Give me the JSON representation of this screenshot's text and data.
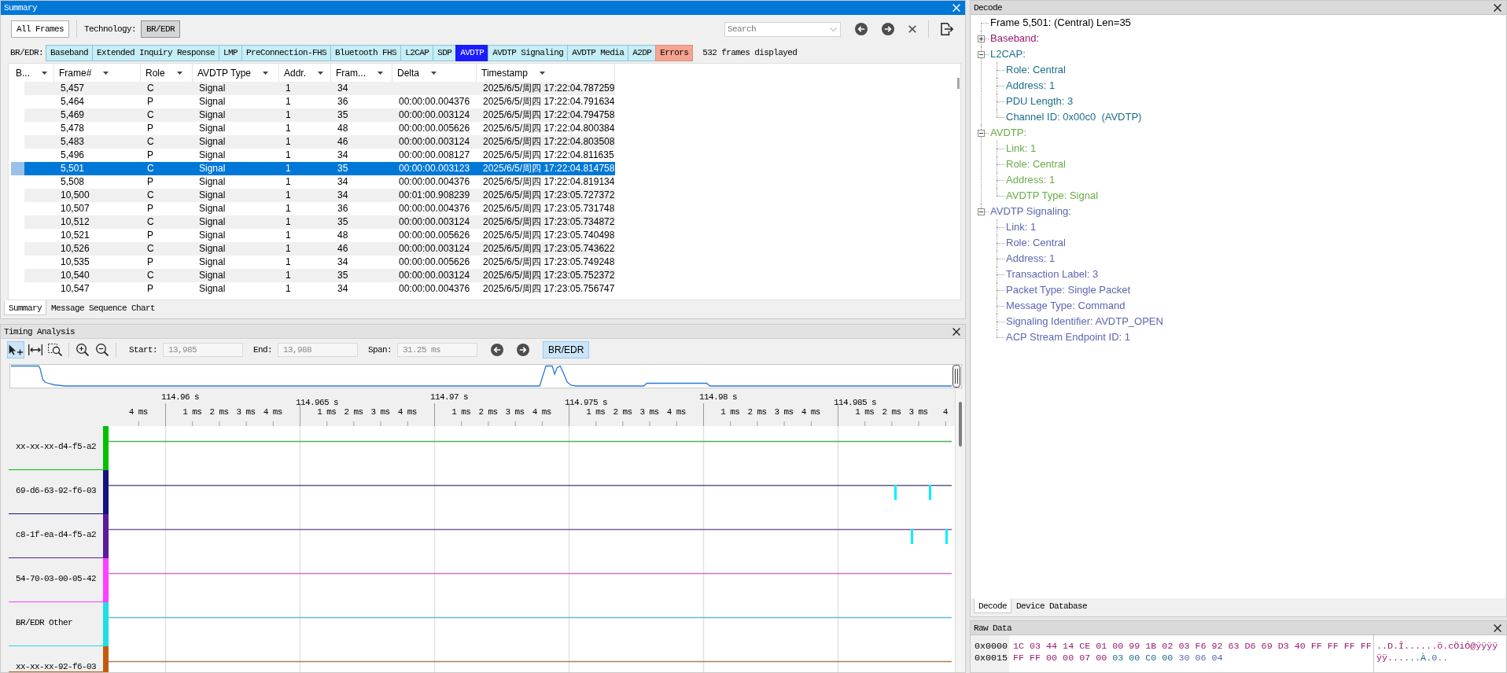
{
  "summary": {
    "title": "Summary",
    "toolbar": {
      "all_frames": {
        "label": "All Frames",
        "selected": false
      },
      "technology_label": "Technology:",
      "technology": {
        "label": "BR/EDR",
        "selected": true
      },
      "search": {
        "placeholder": "Search"
      }
    },
    "filter": {
      "label": "BR/EDR:",
      "tabs": [
        {
          "label": "Baseband",
          "kind": "protocol",
          "selected": false
        },
        {
          "label": "Extended Inquiry Response",
          "kind": "protocol",
          "selected": false
        },
        {
          "label": "LMP",
          "kind": "protocol",
          "selected": false
        },
        {
          "label": "PreConnection-FHS",
          "kind": "protocol",
          "selected": false
        },
        {
          "label": "Bluetooth FHS",
          "kind": "protocol",
          "selected": false
        },
        {
          "label": "L2CAP",
          "kind": "protocol",
          "selected": false
        },
        {
          "label": "SDP",
          "kind": "protocol",
          "selected": false
        },
        {
          "label": "AVDTP",
          "kind": "protocol",
          "selected": true
        },
        {
          "label": "AVDTP Signaling",
          "kind": "protocol",
          "selected": false
        },
        {
          "label": "AVDTP Media",
          "kind": "protocol",
          "selected": false
        },
        {
          "label": "A2DP",
          "kind": "protocol",
          "selected": false
        },
        {
          "label": "Errors",
          "kind": "errors",
          "selected": false
        }
      ],
      "count": "532 frames displayed"
    },
    "table": {
      "columns": [
        "B...",
        "Frame#",
        "Role",
        "AVDTP Type",
        "Addr.",
        "Fram...",
        "Delta",
        "Timestamp"
      ],
      "rows": [
        {
          "frame": "5,457",
          "role": "C",
          "avdtp_type": "Signal",
          "addr": "1",
          "column_6": "34",
          "timestamp": "2025/6/5/周四 17:22:04.787259",
          "selected": false
        },
        {
          "frame": "5,464",
          "role": "P",
          "avdtp_type": "Signal",
          "addr": "1",
          "column_6": "36",
          "delta": "00:00:00.004376",
          "timestamp": "2025/6/5/周四 17:22:04.791634",
          "selected": false
        },
        {
          "frame": "5,469",
          "role": "C",
          "avdtp_type": "Signal",
          "addr": "1",
          "column_6": "35",
          "delta": "00:00:00.003124",
          "timestamp": "2025/6/5/周四 17:22:04.794758",
          "selected": false
        },
        {
          "frame": "5,478",
          "role": "P",
          "avdtp_type": "Signal",
          "addr": "1",
          "column_6": "48",
          "delta": "00:00:00.005626",
          "timestamp": "2025/6/5/周四 17:22:04.800384",
          "selected": false
        },
        {
          "frame": "5,483",
          "role": "C",
          "avdtp_type": "Signal",
          "addr": "1",
          "column_6": "46",
          "delta": "00:00:00.003124",
          "timestamp": "2025/6/5/周四 17:22:04.803508",
          "selected": false
        },
        {
          "frame": "5,496",
          "role": "P",
          "avdtp_type": "Signal",
          "addr": "1",
          "column_6": "34",
          "delta": "00:00:00.008127",
          "timestamp": "2025/6/5/周四 17:22:04.811635",
          "selected": false
        },
        {
          "frame": "5,501",
          "role": "C",
          "avdtp_type": "Signal",
          "addr": "1",
          "column_6": "35",
          "delta": "00:00:00.003123",
          "timestamp": "2025/6/5/周四 17:22:04.814758",
          "selected": true
        },
        {
          "frame": "5,508",
          "role": "P",
          "avdtp_type": "Signal",
          "addr": "1",
          "column_6": "34",
          "delta": "00:00:00.004376",
          "timestamp": "2025/6/5/周四 17:22:04.819134",
          "selected": false
        },
        {
          "frame": "10,500",
          "role": "C",
          "avdtp_type": "Signal",
          "addr": "1",
          "column_6": "34",
          "delta": "00:01:00.908239",
          "timestamp": "2025/6/5/周四 17:23:05.727372",
          "selected": false
        },
        {
          "frame": "10,507",
          "role": "P",
          "avdtp_type": "Signal",
          "addr": "1",
          "column_6": "36",
          "delta": "00:00:00.004376",
          "timestamp": "2025/6/5/周四 17:23:05.731748",
          "selected": false
        },
        {
          "frame": "10,512",
          "role": "C",
          "avdtp_type": "Signal",
          "addr": "1",
          "column_6": "35",
          "delta": "00:00:00.003124",
          "timestamp": "2025/6/5/周四 17:23:05.734872",
          "selected": false
        },
        {
          "frame": "10,521",
          "role": "P",
          "avdtp_type": "Signal",
          "addr": "1",
          "column_6": "48",
          "delta": "00:00:00.005626",
          "timestamp": "2025/6/5/周四 17:23:05.740498",
          "selected": false
        },
        {
          "frame": "10,526",
          "role": "C",
          "avdtp_type": "Signal",
          "addr": "1",
          "column_6": "46",
          "delta": "00:00:00.003124",
          "timestamp": "2025/6/5/周四 17:23:05.743622",
          "selected": false
        },
        {
          "frame": "10,535",
          "role": "P",
          "avdtp_type": "Signal",
          "addr": "1",
          "column_6": "34",
          "delta": "00:00:00.005626",
          "timestamp": "2025/6/5/周四 17:23:05.749248",
          "selected": false
        },
        {
          "frame": "10,540",
          "role": "C",
          "avdtp_type": "Signal",
          "addr": "1",
          "column_6": "35",
          "delta": "00:00:00.003124",
          "timestamp": "2025/6/5/周四 17:23:05.752372",
          "selected": false
        },
        {
          "frame": "10,547",
          "role": "P",
          "avdtp_type": "Signal",
          "addr": "1",
          "column_6": "34",
          "delta": "00:00:00.004376",
          "timestamp": "2025/6/5/周四 17:23:05.756747",
          "selected": false
        }
      ]
    },
    "tabs": [
      {
        "label": "Summary",
        "selected": true
      },
      {
        "label": "Message Sequence Chart",
        "selected": false
      }
    ]
  },
  "timing": {
    "title": "Timing Analysis",
    "tools": [
      {
        "kind": "pointer",
        "selected": true
      },
      {
        "kind": "fit",
        "selected": false
      },
      {
        "kind": "zoom_region",
        "selected": false
      },
      {
        "kind": "zoom_in",
        "selected": false
      },
      {
        "kind": "zoom_out",
        "selected": false
      }
    ],
    "fields": [
      {
        "label": "Start:",
        "value": "13,985",
        "disabled": true
      },
      {
        "label": "End:",
        "value": "13,988",
        "disabled": true
      },
      {
        "label": "Span:",
        "value": "31.25 ms",
        "disabled": true
      }
    ],
    "technology": {
      "label": "BR/EDR",
      "selected": true
    },
    "ruler": {
      "lead_ticks": [
        "4 ms"
      ],
      "segments": [
        {
          "label": "114.96 s",
          "ticks": [
            "1 ms",
            "2 ms",
            "3 ms",
            "4 ms"
          ]
        },
        {
          "label": "114.965 s",
          "ticks": [
            "1 ms",
            "2 ms",
            "3 ms",
            "4 ms"
          ]
        },
        {
          "label": "114.97 s",
          "ticks": [
            "1 ms",
            "2 ms",
            "3 ms",
            "4 ms"
          ]
        },
        {
          "label": "114.975 s",
          "ticks": [
            "1 ms",
            "2 ms",
            "3 ms",
            "4 ms"
          ]
        },
        {
          "label": "114.98 s",
          "ticks": [
            "1 ms",
            "2 ms",
            "3 ms",
            "4 ms"
          ]
        },
        {
          "label": "114.985 s",
          "ticks": [
            "1 ms",
            "2 ms",
            "3 ms",
            "4"
          ]
        }
      ]
    },
    "lanes": [
      {
        "label": "xx-xx-xx-d4-f5-a2",
        "color": "#00c000"
      },
      {
        "label": "69-d6-63-92-f6-03",
        "color": "#14147c"
      },
      {
        "label": "c8-1f-ea-d4-f5-a2",
        "color": "#5a1c98"
      },
      {
        "label": "54-70-03-00-05-42",
        "color": "#ff40ff"
      },
      {
        "label": "BR/EDR Other",
        "color": "#20dde8"
      },
      {
        "label": "xx-xx-xx-92-f6-03",
        "color": "#c05c10"
      }
    ]
  },
  "decode": {
    "title": "Decode",
    "tree": [
      {
        "text": "Frame 5,501: (Central) Len=35"
      },
      {
        "text": "Baseband:",
        "color": "#9b1b6e",
        "expanded": false
      },
      {
        "text": "L2CAP:",
        "color": "#1b6e8a",
        "expanded": true,
        "children": [
          {
            "text": "Role: Central"
          },
          {
            "text": "Address: 1"
          },
          {
            "text": "PDU Length: 3"
          },
          {
            "text": "Channel ID: 0x00c0  (AVDTP)"
          }
        ]
      },
      {
        "text": "AVDTP:",
        "color": "#6aab46",
        "expanded": true,
        "children": [
          {
            "text": "Link: 1"
          },
          {
            "text": "Role: Central"
          },
          {
            "text": "Address: 1"
          },
          {
            "text": "AVDTP Type: Signal"
          }
        ]
      },
      {
        "text": "AVDTP Signaling:",
        "color": "#5b67b0",
        "expanded": true,
        "children": [
          {
            "text": "Link: 1"
          },
          {
            "text": "Role: Central"
          },
          {
            "text": "Address: 1"
          },
          {
            "text": "Transaction Label: 3"
          },
          {
            "text": "Packet Type: Single Packet"
          },
          {
            "text": "Message Type: Command"
          },
          {
            "text": "Signaling Identifier: AVDTP_OPEN"
          },
          {
            "text": "ACP Stream Endpoint ID: 1"
          }
        ]
      }
    ],
    "tabs": [
      {
        "label": "Decode",
        "selected": true
      },
      {
        "label": "Device Database",
        "selected": false
      }
    ]
  },
  "raw_data": {
    "title": "Raw Data",
    "rows": [
      {
        "offset": "0x0000",
        "segments": [
          {
            "bytes": "1C 03 44 14 CE 01 00 99 1B 02 03 F6 92 63 D6 69 D3 40 FF FF FF FF",
            "ascii": "..D.Î......ö.cÖiÓ@ÿÿÿÿ",
            "color": "#9b1b6e"
          }
        ]
      },
      {
        "offset": "0x0015",
        "segments": [
          {
            "bytes": "FF FF 00 00 07 00",
            "ascii": "ÿÿ....",
            "color": "#9b1b6e"
          },
          {
            "bytes": "03 00 C0 00",
            "ascii": "..À.",
            "color": "#1b6e8a"
          },
          {
            "bytes": "30 06 04",
            "ascii": "0..",
            "color": "#5b67b0"
          }
        ]
      }
    ]
  }
}
